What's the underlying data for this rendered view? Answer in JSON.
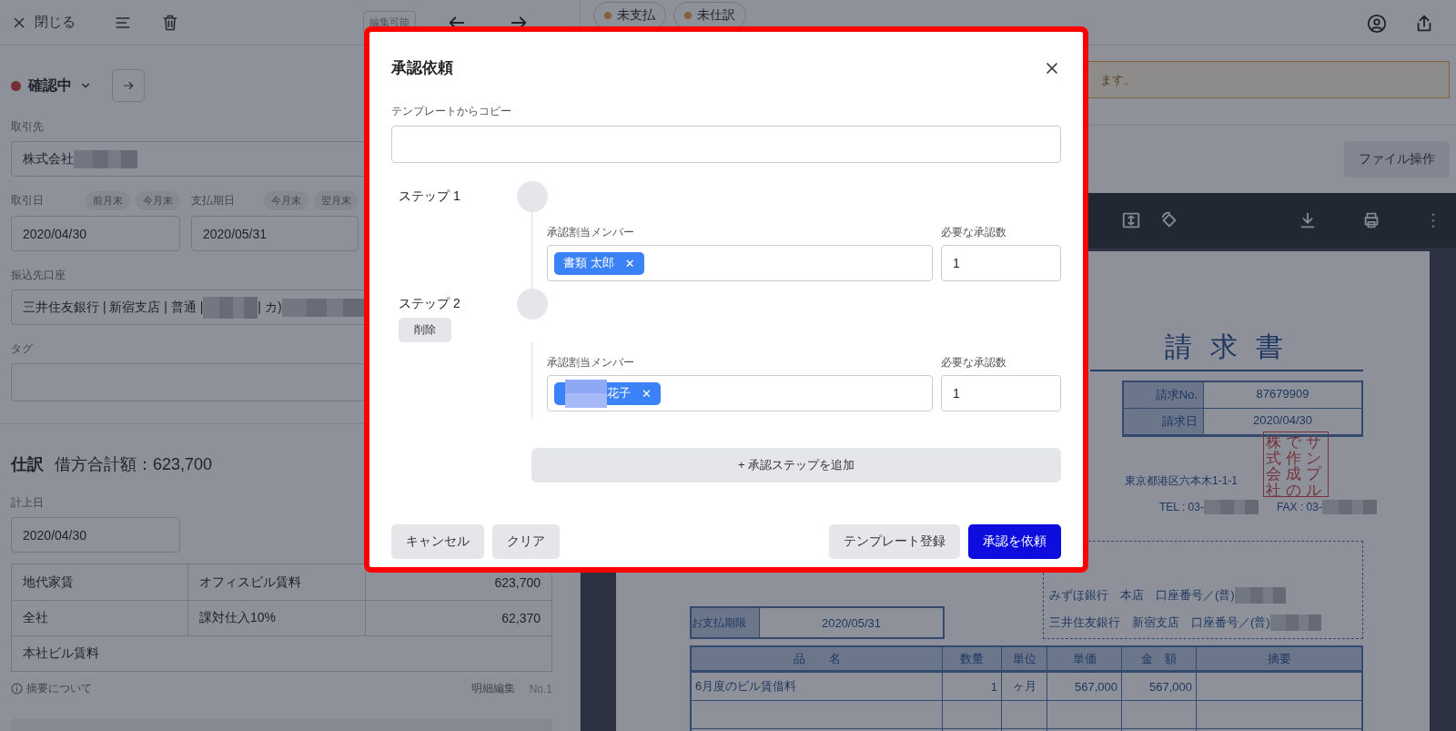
{
  "topbar": {
    "close_label": "閉じる",
    "badge": "編集可能"
  },
  "status": {
    "label": "確認中"
  },
  "form": {
    "partner": {
      "label": "取引先",
      "value": "株式会社"
    },
    "dates": [
      {
        "label": "取引日",
        "shortcuts": [
          "前月末",
          "今月末"
        ],
        "value": "2020/04/30"
      },
      {
        "label": "支払期日",
        "shortcuts": [
          "今月末",
          "翌月末"
        ],
        "value": "2020/05/31"
      }
    ],
    "account": {
      "label": "振込先口座",
      "value_parts": [
        "三井住友銀行 | 新宿支店 | 普通 |",
        "| カ)"
      ]
    },
    "tag": {
      "label": "タグ"
    }
  },
  "journal": {
    "title": "仕訳",
    "total": "借方合計額：623,700",
    "date_label": "計上日",
    "date_value": "2020/04/30",
    "rows": [
      [
        "地代家賃",
        "オフィスビル賃料",
        "623,700"
      ],
      [
        "全社",
        "課対仕入10%",
        "62,370"
      ],
      [
        "本社ビル賃料"
      ]
    ],
    "note": "摘要について",
    "edit": "明細編集",
    "number": "No.1"
  },
  "header_tags": [
    {
      "label": "未支払"
    },
    {
      "label": "未仕訳"
    }
  ],
  "notice": "ます。",
  "file_button": "ファイル操作",
  "invoice": {
    "title": "請 求 書",
    "info": [
      [
        "請求No.",
        "87679909"
      ],
      [
        "請求日",
        "2020/04/30"
      ]
    ],
    "address": "東京都港区六本木1-1-1",
    "tel": "TEL : 03-",
    "fax": "FAX : 03-",
    "stamp_columns": [
      "株式会社",
      "で作成の",
      "サンプル"
    ],
    "banks": [
      "みずほ銀行　本店　口座番号／(普)",
      "三井住友銀行　新宿支店　口座番号／(普)"
    ],
    "due_label": "お支払期限",
    "due_value": "2020/05/31",
    "columns": [
      "品　　名",
      "数量",
      "単位",
      "単価",
      "金　額",
      "摘要"
    ],
    "rows": [
      [
        "6月度のビル賃借料",
        "1",
        "ヶ月",
        "567,000",
        "567,000",
        ""
      ]
    ]
  },
  "modal": {
    "title": "承認依頼",
    "template_label": "テンプレートからコピー",
    "steps": [
      {
        "label": "ステップ 1",
        "member_label": "承認割当メンバー",
        "members": [
          {
            "name": "書類 太郎",
            "masked": false,
            "remove": "✕"
          }
        ],
        "count_label": "必要な承認数",
        "count": "1"
      },
      {
        "label": "ステップ 2",
        "delete_label": "削除",
        "member_label": "承認割当メンバー",
        "members": [
          {
            "name": "花子",
            "masked": true,
            "remove": "✕"
          }
        ],
        "count_label": "必要な承認数",
        "count": "1"
      }
    ],
    "add_step": "+ 承認ステップを追加",
    "left_buttons": [
      {
        "label": "キャンセル",
        "kind": "secondary"
      },
      {
        "label": "クリア",
        "kind": "secondary"
      }
    ],
    "right_buttons": [
      {
        "label": "テンプレート登録",
        "kind": "secondary"
      },
      {
        "label": "承認を依頼",
        "kind": "primary"
      }
    ]
  }
}
